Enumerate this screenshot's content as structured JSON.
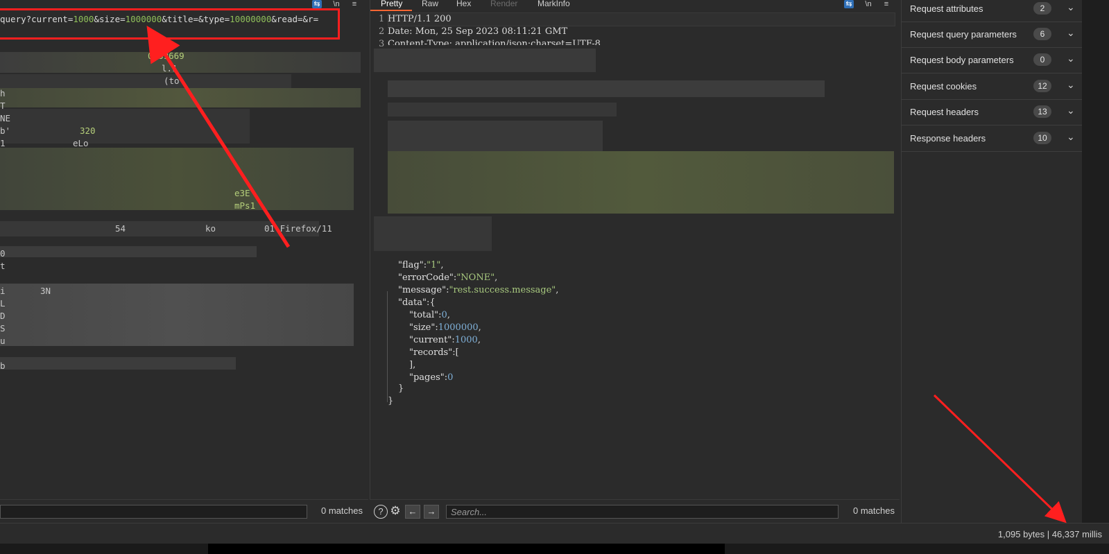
{
  "request": {
    "toolbar_icons": [
      "wrap-icon",
      "newline-icon",
      "menu-icon"
    ],
    "first_line": {
      "path": "query?current=",
      "current_val": "1000",
      "size_key": "&size=",
      "size_val": "1000000",
      "title_key": "&title=",
      "type_key": "&type=",
      "type_val": "10000000",
      "tail": "&read=&r="
    },
    "fragments": [
      {
        "text": "0569669",
        "green": true
      },
      {
        "text": "l.1",
        "green": false
      },
      {
        "text": "(to",
        "green": false
      },
      {
        "text": "h",
        "green": false
      },
      {
        "text": "T",
        "green": false
      },
      {
        "text": "NE",
        "green": false
      },
      {
        "text": "b'",
        "green": false
      },
      {
        "text": "320",
        "green": true
      },
      {
        "text": "1",
        "green": false
      },
      {
        "text": "eLo",
        "green": false
      },
      {
        "text": "e3E",
        "green": true
      },
      {
        "text": "mPs1",
        "green": true
      },
      {
        "text": "54",
        "green": false
      },
      {
        "text": "ko",
        "green": false
      },
      {
        "text": "01 Firefox/11",
        "green": false
      },
      {
        "text": "0",
        "green": false
      },
      {
        "text": "t",
        "green": false
      },
      {
        "text": "i",
        "green": false
      },
      {
        "text": "3N",
        "green": false
      },
      {
        "text": "L",
        "green": false
      },
      {
        "text": "D",
        "green": false
      },
      {
        "text": "S",
        "green": false
      },
      {
        "text": "u",
        "green": false
      },
      {
        "text": "b",
        "green": false
      }
    ],
    "search": {
      "placeholder": "",
      "matches": "0 matches"
    }
  },
  "response": {
    "tabs": [
      {
        "label": "Pretty",
        "state": "active"
      },
      {
        "label": "Raw",
        "state": "normal"
      },
      {
        "label": "Hex",
        "state": "normal"
      },
      {
        "label": "Render",
        "state": "disabled"
      },
      {
        "label": "MarkInfo",
        "state": "normal"
      }
    ],
    "header_lines": [
      {
        "num": "1",
        "text": "HTTP/1.1 200"
      },
      {
        "num": "2",
        "text": "Date: Mon, 25 Sep 2023 08:11:21 GMT"
      },
      {
        "num": "3",
        "text": "Content-Type: application/json;charset=UTF-8"
      }
    ],
    "json": {
      "flag_key": "\"flag\"",
      "flag_val": "\"1\"",
      "errorCode_key": "\"errorCode\"",
      "errorCode_val": "\"NONE\"",
      "message_key": "\"message\"",
      "message_val": "\"rest.success.message\"",
      "data_key": "\"data\"",
      "total_key": "\"total\"",
      "total_val": "0",
      "size_key": "\"size\"",
      "size_val": "1000000",
      "current_key": "\"current\"",
      "current_val": "1000",
      "records_key": "\"records\"",
      "pages_key": "\"pages\"",
      "pages_val": "0"
    },
    "search": {
      "placeholder": "Search...",
      "matches": "0 matches"
    }
  },
  "inspector": {
    "rows": [
      {
        "label": "Request attributes",
        "count": "2"
      },
      {
        "label": "Request query parameters",
        "count": "6"
      },
      {
        "label": "Request body parameters",
        "count": "0"
      },
      {
        "label": "Request cookies",
        "count": "12"
      },
      {
        "label": "Request headers",
        "count": "13"
      },
      {
        "label": "Response headers",
        "count": "10"
      }
    ]
  },
  "status": {
    "text": "1,095 bytes | 46,337 millis"
  },
  "colors": {
    "highlight": "#ff1f1f",
    "accent_tab": "#ff6633",
    "json_value": "#a8c97f",
    "json_number": "#7fb0d8"
  }
}
